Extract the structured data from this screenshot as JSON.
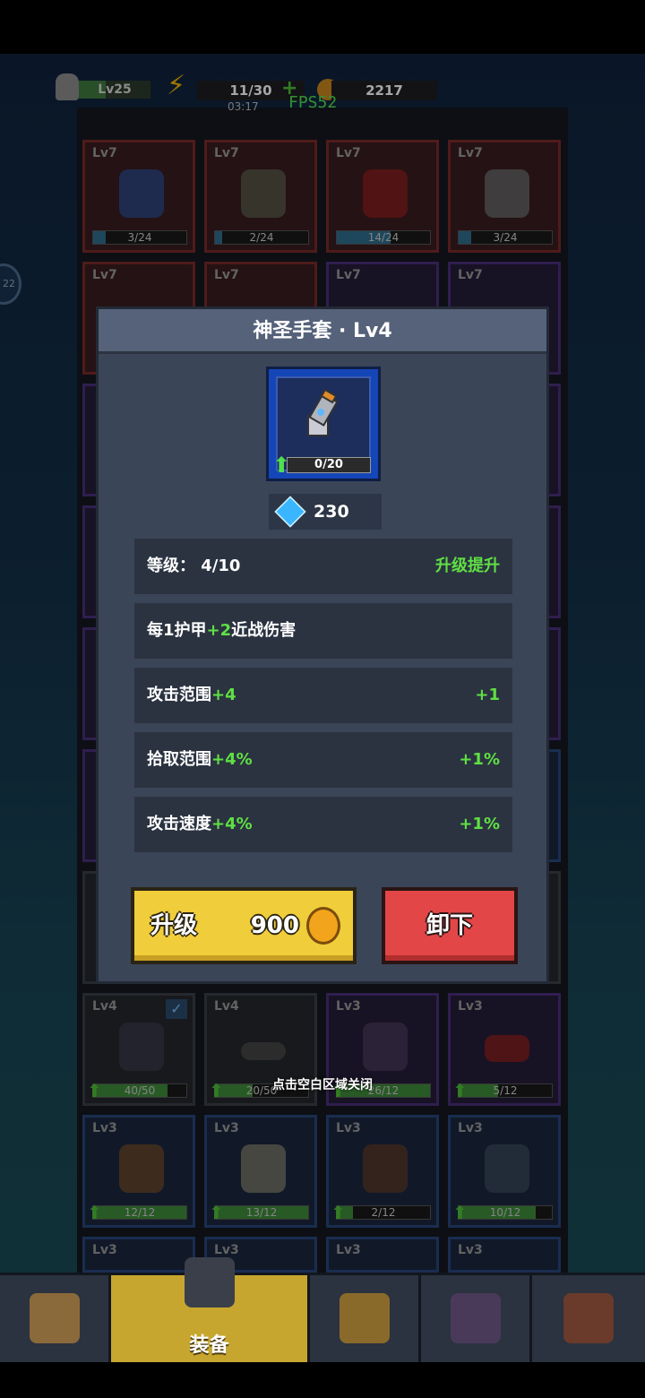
{
  "hud": {
    "level": "Lv25",
    "energy": "11/30",
    "energy_timer": "03:17",
    "coins": "2217",
    "fps": "FPS52",
    "side_badge": "22"
  },
  "grid_rows": [
    {
      "slots": [
        {
          "lv": "Lv7",
          "progress": "3/24"
        },
        {
          "lv": "Lv7",
          "progress": "2/24"
        },
        {
          "lv": "Lv7",
          "progress": "14/24"
        },
        {
          "lv": "Lv7",
          "progress": "3/24"
        }
      ]
    },
    {
      "slots": [
        {
          "lv": "Lv7"
        },
        {
          "lv": "Lv7"
        },
        {
          "lv": "Lv7"
        },
        {
          "lv": "Lv7"
        }
      ]
    },
    {
      "slots": [
        {
          "lv": "Lv4",
          "progress": "40/50"
        },
        {
          "lv": "Lv4",
          "progress": "20/50"
        },
        {
          "lv": "Lv3",
          "progress": "26/12"
        },
        {
          "lv": "Lv3",
          "progress": "5/12"
        }
      ]
    },
    {
      "slots": [
        {
          "lv": "Lv3",
          "progress": "12/12"
        },
        {
          "lv": "Lv3",
          "progress": "13/12"
        },
        {
          "lv": "Lv3",
          "progress": "2/12"
        },
        {
          "lv": "Lv3",
          "progress": "10/12"
        }
      ]
    },
    {
      "slots": [
        {
          "lv": "Lv3"
        },
        {
          "lv": "Lv3"
        },
        {
          "lv": "Lv3"
        },
        {
          "lv": "Lv3"
        }
      ]
    }
  ],
  "close_hint": "点击空白区域关闭",
  "modal": {
    "title": "神圣手套 · Lv4",
    "item_progress": "0/20",
    "gem_cost": "230",
    "rows": [
      {
        "left": "等级： 4/10",
        "right": "升级提升"
      },
      {
        "left_pre": "每1护甲",
        "left_hl": "+2",
        "left_post": "近战伤害"
      },
      {
        "left_pre": "攻击范围",
        "left_hl": "+4",
        "right": "+1"
      },
      {
        "left_pre": "拾取范围",
        "left_hl": "+4%",
        "right": "+1%"
      },
      {
        "left_pre": "攻击速度",
        "left_hl": "+4%",
        "right": "+1%"
      }
    ],
    "upgrade_label": "升级",
    "upgrade_price": "900",
    "unequip_label": "卸下"
  },
  "nav": {
    "equip_label": "装备"
  },
  "colors": {
    "accent_green": "#5fe043",
    "upgrade_yellow": "#f0cd3a",
    "unequip_red": "#e34646",
    "rare_blue": "#1546b8"
  }
}
